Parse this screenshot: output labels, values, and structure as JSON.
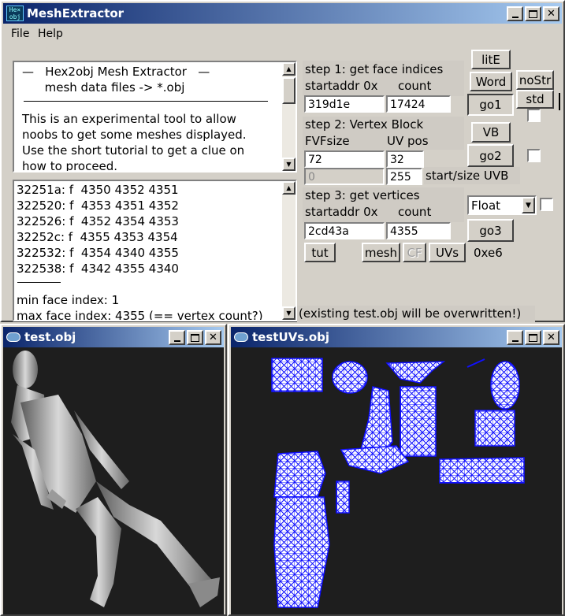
{
  "main_window": {
    "title": "MeshExtractor",
    "icon_text": "Hex2obj"
  },
  "menu": {
    "file": "File",
    "help": "Help"
  },
  "info_text": {
    "lines": [
      "—   Hex2obj Mesh Extractor   —",
      "      mesh data files -> *.obj",
      "",
      "This is an experimental tool to allow",
      "noobs to get some meshes displayed.",
      "Use the short tutorial to get a clue on",
      "how to proceed."
    ]
  },
  "output_text": {
    "lines": [
      "32251a: f  4350 4352 4351",
      "322520: f  4353 4351 4352",
      "322526: f  4352 4354 4353",
      "32252c: f  4355 4353 4354",
      "322532: f  4354 4340 4355",
      "322538: f  4342 4355 4340",
      "",
      "min face index: 1",
      "max face index: 4355 (== vertex count?)"
    ]
  },
  "step1": {
    "title": "step 1: get face indices",
    "startaddr_label": "startaddr 0x",
    "count_label": "count",
    "startaddr_value": "319d1e",
    "count_value": "17424",
    "go_label": "go1"
  },
  "step2": {
    "title": "step 2: Vertex Block",
    "fvf_label": "FVFsize",
    "uvpos_label": "UV pos",
    "fvf_value": "72",
    "uvpos_value": "32",
    "uvb_start_value": "0",
    "uvb_size_value": "255",
    "uvb_label": "start/size UVB",
    "vb_label": "VB",
    "go_label": "go2"
  },
  "step3": {
    "title": "step 3: get vertices",
    "startaddr_label": "startaddr 0x",
    "count_label": "count",
    "startaddr_value": "2cd43a",
    "count_value": "4355",
    "format_selected": "Float",
    "go_label": "go3"
  },
  "buttons": {
    "litE": "litE",
    "word": "Word",
    "nostr": "noStr",
    "std": "std",
    "tut": "tut",
    "mesh": "mesh",
    "cf": "CF",
    "uvs": "UVs"
  },
  "hex_readout": "0xe6",
  "warning": "(existing test.obj will be overwritten!)",
  "obj_window": {
    "title": "test.obj"
  },
  "uv_window": {
    "title": "testUVs.obj"
  },
  "colors": {
    "uv_wire": "#1010ff",
    "viewport_bg": "#1e1e1e",
    "title_active": "#0a246a"
  }
}
